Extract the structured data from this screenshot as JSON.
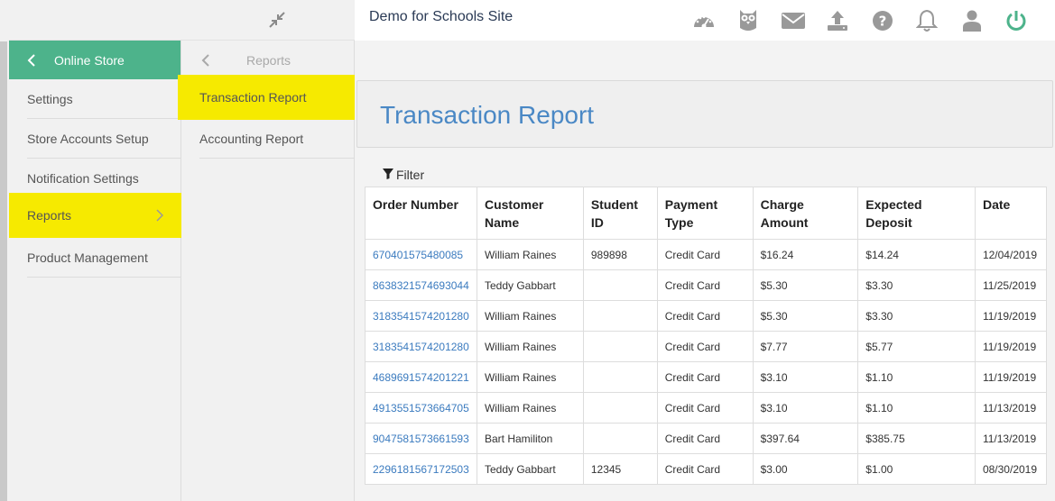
{
  "site_title": "Demo for Schools Site",
  "toolbar_icons": [
    "dashboard-icon",
    "owl-icon",
    "mail-icon",
    "upload-icon",
    "help-icon",
    "bell-icon",
    "user-icon",
    "power-icon"
  ],
  "colors": {
    "accent_green": "#4db38b",
    "highlight": "#f6ea00",
    "link": "#3b7bbf",
    "title_blue": "#4a88c5"
  },
  "menu1": {
    "header": "Online Store",
    "items": [
      "Settings",
      "Store Accounts Setup",
      "Notification Settings",
      "Reports",
      "Product Management"
    ]
  },
  "menu2": {
    "header": "Reports",
    "items": [
      "Transaction Report",
      "Accounting Report"
    ]
  },
  "main": {
    "title": "Transaction Report",
    "filter_label": "Filter",
    "table": {
      "headers": [
        "Order Number",
        "Customer Name",
        "Student ID",
        "Payment Type",
        "Charge Amount",
        "Expected Deposit",
        "Date"
      ],
      "rows": [
        [
          "670401575480085",
          "William Raines",
          "989898",
          "Credit Card",
          "$16.24",
          "$14.24",
          "12/04/2019"
        ],
        [
          "8638321574693044",
          "Teddy Gabbart",
          "",
          "Credit Card",
          "$5.30",
          "$3.30",
          "11/25/2019"
        ],
        [
          "3183541574201280",
          "William Raines",
          "",
          "Credit Card",
          "$5.30",
          "$3.30",
          "11/19/2019"
        ],
        [
          "3183541574201280",
          "William Raines",
          "",
          "Credit Card",
          "$7.77",
          "$5.77",
          "11/19/2019"
        ],
        [
          "4689691574201221",
          "William Raines",
          "",
          "Credit Card",
          "$3.10",
          "$1.10",
          "11/19/2019"
        ],
        [
          "4913551573664705",
          "William Raines",
          "",
          "Credit Card",
          "$3.10",
          "$1.10",
          "11/13/2019"
        ],
        [
          "9047581573661593",
          "Bart Hamiliton",
          "",
          "Credit Card",
          "$397.64",
          "$385.75",
          "11/13/2019"
        ],
        [
          "2296181567172503",
          "Teddy Gabbart",
          "12345",
          "Credit Card",
          "$3.00",
          "$1.00",
          "08/30/2019"
        ]
      ]
    }
  }
}
